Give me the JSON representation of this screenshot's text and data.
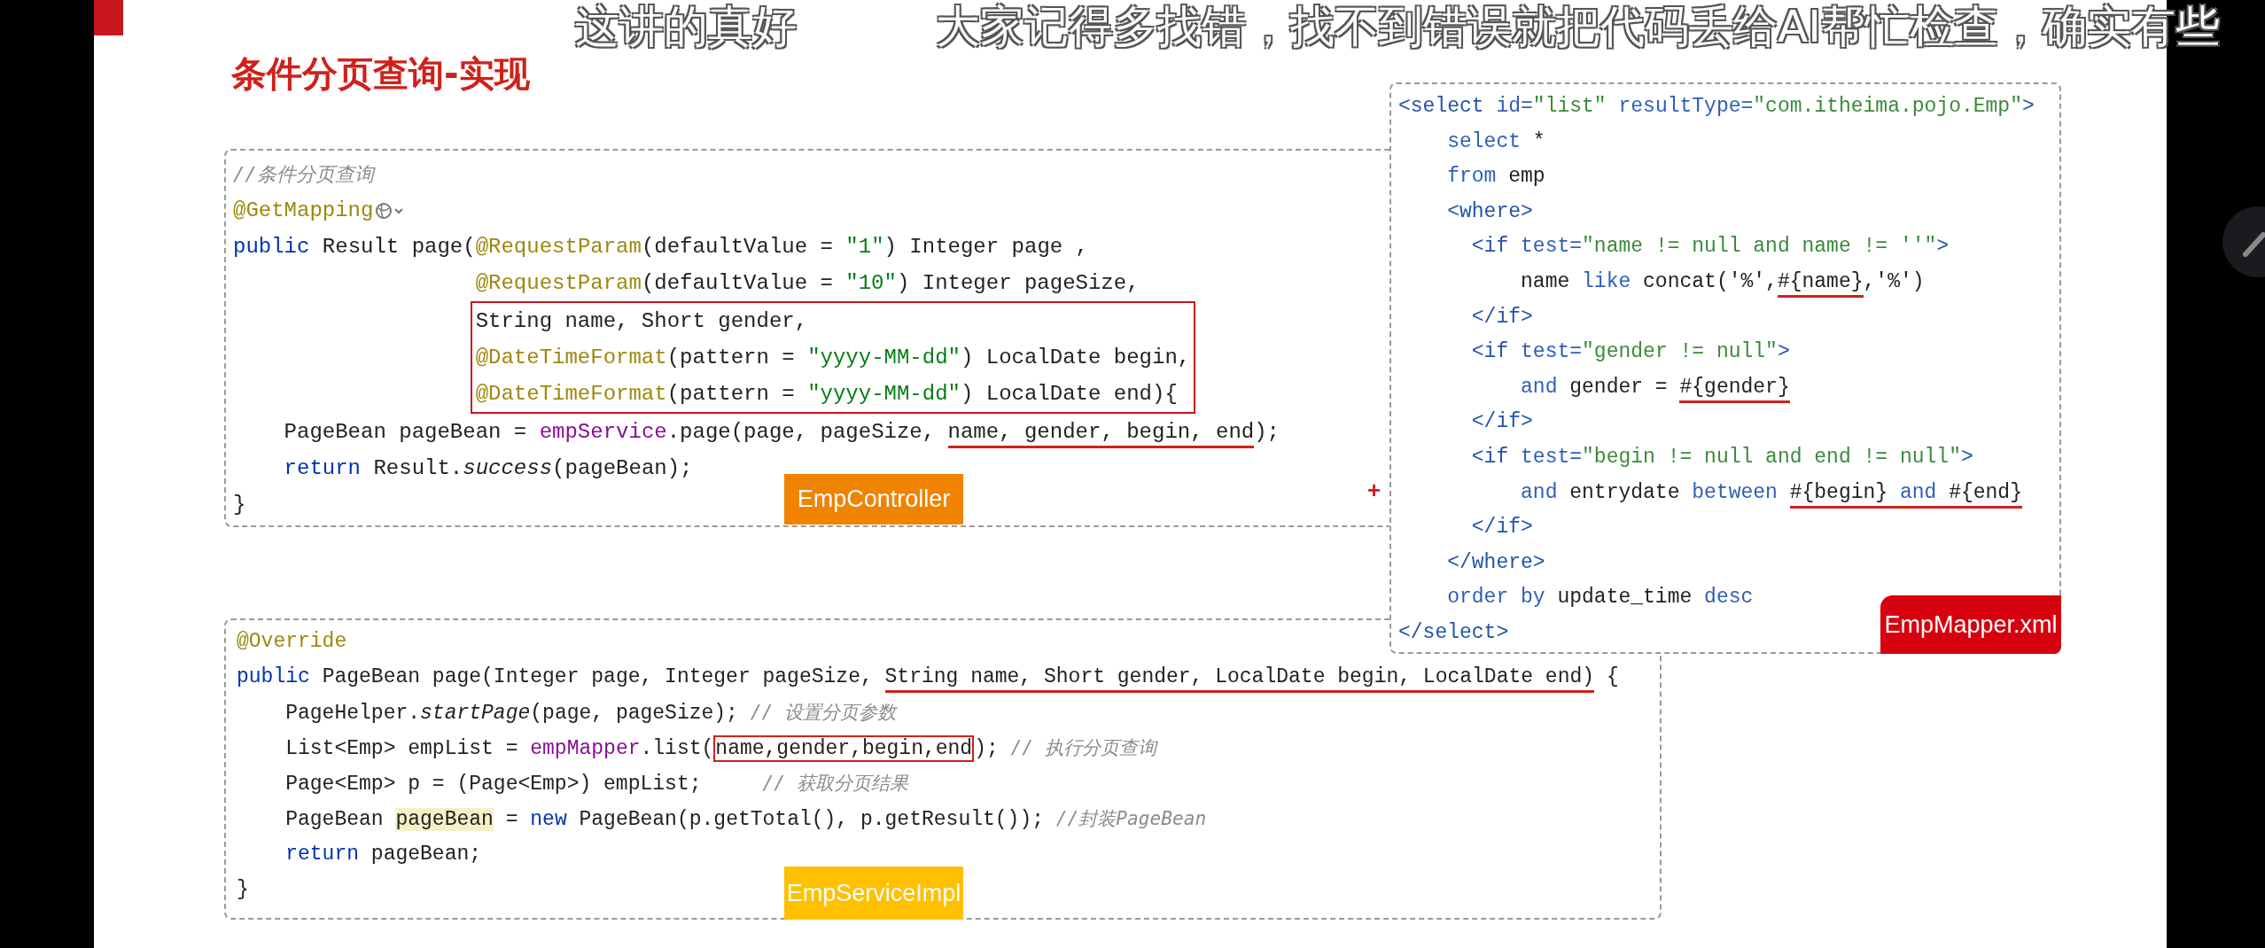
{
  "danmaku": [
    "这讲的真好",
    "大家记得多找错，找不到错误就把代码丢给AI帮忙检查，确实有些"
  ],
  "slide": {
    "title": "条件分页查询-实现",
    "controller": {
      "label": "EmpController",
      "plus": "+",
      "lines": [
        {
          "segments": [
            {
              "text": "//条件分页查询",
              "kind": "cmt"
            }
          ]
        },
        {
          "segments": [
            {
              "text": "@GetMapping",
              "kind": "ann"
            }
          ],
          "endpoint_icon": true
        },
        {
          "segments": [
            {
              "text": "public",
              "kind": "kw"
            },
            {
              "text": " Result page(",
              "kind": "p"
            },
            {
              "text": "@RequestParam",
              "kind": "ann"
            },
            {
              "text": "(defaultValue = ",
              "kind": "p"
            },
            {
              "text": "\"1\"",
              "kind": "str"
            },
            {
              "text": ") Integer page ,",
              "kind": "p"
            }
          ]
        },
        {
          "segments": [
            {
              "text": "                   @RequestParam",
              "kind": "ann"
            },
            {
              "text": "(defaultValue = ",
              "kind": "p"
            },
            {
              "text": "\"10\"",
              "kind": "str"
            },
            {
              "text": ") Integer pageSize,",
              "kind": "p"
            }
          ]
        },
        {
          "boxed": true,
          "segments": [
            {
              "text": "String name, Short gender,",
              "kind": "p"
            }
          ]
        },
        {
          "boxed": true,
          "segments": [
            {
              "text": "@DateTimeFormat",
              "kind": "ann"
            },
            {
              "text": "(pattern = ",
              "kind": "p"
            },
            {
              "text": "\"yyyy-MM-dd\"",
              "kind": "str"
            },
            {
              "text": ") LocalDate begin,",
              "kind": "p"
            }
          ]
        },
        {
          "boxed": true,
          "segments": [
            {
              "text": "@DateTimeFormat",
              "kind": "ann"
            },
            {
              "text": "(pattern = ",
              "kind": "p"
            },
            {
              "text": "\"yyyy-MM-dd\"",
              "kind": "str"
            },
            {
              "text": ") LocalDate end){",
              "kind": "p"
            }
          ]
        },
        {
          "segments": [
            {
              "text": "    PageBean pageBean = ",
              "kind": "p"
            },
            {
              "text": "empService",
              "kind": "field"
            },
            {
              "text": ".page(page, pageSize, ",
              "kind": "p"
            },
            {
              "text": "name, gender, begin, end",
              "kind": "p",
              "underlined": true
            },
            {
              "text": ");",
              "kind": "p"
            }
          ]
        },
        {
          "segments": [
            {
              "text": "    return",
              "kind": "kw"
            },
            {
              "text": " Result.",
              "kind": "p"
            },
            {
              "text": "success",
              "kind": "italic"
            },
            {
              "text": "(pageBean);",
              "kind": "p"
            }
          ]
        },
        {
          "segments": [
            {
              "text": "}",
              "kind": "p"
            }
          ]
        }
      ]
    },
    "mapper": {
      "label": "EmpMapper.xml",
      "lines": [
        {
          "segments": [
            {
              "text": "<select",
              "kind": "tag"
            },
            {
              "text": " id=",
              "kind": "attr"
            },
            {
              "text": "\"list\"",
              "kind": "str"
            },
            {
              "text": " resultType=",
              "kind": "attr"
            },
            {
              "text": "\"com.itheima.pojo.Emp\"",
              "kind": "str"
            },
            {
              "text": ">",
              "kind": "tag"
            }
          ]
        },
        {
          "segments": [
            {
              "text": "    select",
              "kind": "sql"
            },
            {
              "text": " *",
              "kind": "p"
            }
          ]
        },
        {
          "segments": [
            {
              "text": "    from",
              "kind": "sql"
            },
            {
              "text": " emp",
              "kind": "p"
            }
          ]
        },
        {
          "segments": [
            {
              "text": "    <where>",
              "kind": "tag"
            }
          ]
        },
        {
          "segments": [
            {
              "text": "      <if",
              "kind": "tag"
            },
            {
              "text": " test=",
              "kind": "attr"
            },
            {
              "text": "\"name != null and name != ''\"",
              "kind": "str"
            },
            {
              "text": ">",
              "kind": "tag"
            }
          ]
        },
        {
          "segments": [
            {
              "text": "          name ",
              "kind": "p"
            },
            {
              "text": "like",
              "kind": "sql"
            },
            {
              "text": " concat('%',",
              "kind": "p"
            },
            {
              "text": "#{name}",
              "kind": "p",
              "underlined": true
            },
            {
              "text": ",'%')",
              "kind": "p"
            }
          ]
        },
        {
          "segments": [
            {
              "text": "      </if>",
              "kind": "tag"
            }
          ]
        },
        {
          "segments": [
            {
              "text": "      <if",
              "kind": "tag"
            },
            {
              "text": " test=",
              "kind": "attr"
            },
            {
              "text": "\"gender != null\"",
              "kind": "str"
            },
            {
              "text": ">",
              "kind": "tag"
            }
          ]
        },
        {
          "segments": [
            {
              "text": "          and",
              "kind": "sql"
            },
            {
              "text": " gender = ",
              "kind": "p"
            },
            {
              "text": "#{gender}",
              "kind": "p",
              "underlined": true
            }
          ]
        },
        {
          "segments": [
            {
              "text": "      </if>",
              "kind": "tag"
            }
          ]
        },
        {
          "segments": [
            {
              "text": "      <if",
              "kind": "tag"
            },
            {
              "text": " test=",
              "kind": "attr"
            },
            {
              "text": "\"begin != null and end != null\"",
              "kind": "str"
            },
            {
              "text": ">",
              "kind": "tag"
            }
          ]
        },
        {
          "segments": [
            {
              "text": "          and",
              "kind": "sql"
            },
            {
              "text": " entrydate ",
              "kind": "p"
            },
            {
              "text": "between ",
              "kind": "sql"
            },
            {
              "text": "#{begin}",
              "kind": "p",
              "underlined": true
            },
            {
              "text": " and ",
              "kind": "sql",
              "underlined": true
            },
            {
              "text": "#{end}",
              "kind": "p",
              "underlined": true
            }
          ]
        },
        {
          "segments": [
            {
              "text": "      </if>",
              "kind": "tag"
            }
          ]
        },
        {
          "segments": [
            {
              "text": "    </where>",
              "kind": "tag"
            }
          ]
        },
        {
          "segments": [
            {
              "text": "    order by",
              "kind": "sql"
            },
            {
              "text": " update_time ",
              "kind": "p"
            },
            {
              "text": "desc",
              "kind": "sql"
            }
          ]
        },
        {
          "segments": [
            {
              "text": "</select>",
              "kind": "tag"
            }
          ]
        }
      ]
    },
    "service": {
      "label": "EmpServiceImpl",
      "lines": [
        {
          "segments": [
            {
              "text": "@Override",
              "kind": "ann"
            }
          ]
        },
        {
          "segments": [
            {
              "text": "public",
              "kind": "kw"
            },
            {
              "text": " PageBean page(Integer page, Integer pageSize, ",
              "kind": "p"
            },
            {
              "text": "String name, Short gender, LocalDate begin, LocalDate end)",
              "kind": "p",
              "underlined": true
            },
            {
              "text": " {",
              "kind": "p"
            }
          ]
        },
        {
          "segments": [
            {
              "text": "    PageHelper.",
              "kind": "p"
            },
            {
              "text": "startPage",
              "kind": "italic"
            },
            {
              "text": "(page, pageSize); ",
              "kind": "p"
            },
            {
              "text": "// 设置分页参数",
              "kind": "cmt"
            }
          ]
        },
        {
          "segments": [
            {
              "text": "    List<Emp> empList = ",
              "kind": "p"
            },
            {
              "text": "empMapper",
              "kind": "field"
            },
            {
              "text": ".list(",
              "kind": "p"
            },
            {
              "text": "name,gender,begin,end",
              "kind": "p",
              "framed": true
            },
            {
              "text": "); ",
              "kind": "p"
            },
            {
              "text": "// 执行分页查询",
              "kind": "cmt"
            }
          ]
        },
        {
          "segments": [
            {
              "text": "    Page<Emp> p = (Page<Emp>) empList;     ",
              "kind": "p"
            },
            {
              "text": "// 获取分页结果",
              "kind": "cmt"
            }
          ]
        },
        {
          "segments": [
            {
              "text": "    PageBean ",
              "kind": "p"
            },
            {
              "text": "pageBean",
              "kind": "p",
              "highlighted": true
            },
            {
              "text": " = ",
              "kind": "p"
            },
            {
              "text": "new",
              "kind": "kw"
            },
            {
              "text": " PageBean(p.getTotal(), p.getResult()); ",
              "kind": "p"
            },
            {
              "text": "//封装PageBean",
              "kind": "cmt"
            }
          ]
        },
        {
          "segments": [
            {
              "text": "    return",
              "kind": "kw"
            },
            {
              "text": " pageBean;",
              "kind": "p"
            }
          ]
        },
        {
          "segments": [
            {
              "text": "}",
              "kind": "p"
            }
          ]
        }
      ]
    }
  }
}
